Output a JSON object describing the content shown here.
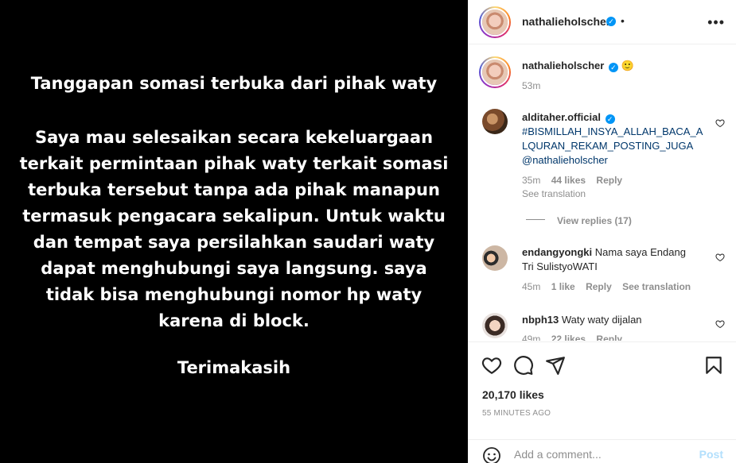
{
  "post_image": {
    "title": "Tanggapan somasi terbuka dari pihak waty",
    "body_lines": [
      "Saya mau selesaikan secara kekeluargaan",
      "terkait permintaan pihak waty terkait somasi",
      "terbuka tersebut tanpa ada pihak manapun",
      "termasuk pengacara sekalipun. Untuk waktu",
      "dan tempat saya persilahkan saudari waty",
      "dapat menghubungi saya langsung. saya",
      "tidak bisa menghubungi nomor hp waty",
      "karena di block."
    ],
    "sign_off": "Terimakasih"
  },
  "header": {
    "username": "nathalieholscher",
    "separator": "•",
    "more_icon": "more-horizontal-icon"
  },
  "caption": {
    "username": "nathalieholscher",
    "text": "🙂",
    "time": "53m"
  },
  "comments": [
    {
      "username": "alditaher.official",
      "verified": true,
      "text_lines": [
        "#BISMILLAH_INSYA_ALLAH_BACA_A",
        "LQURAN_REKAM_POSTING_JUGA"
      ],
      "mention": "@nathalieholscher",
      "time": "35m",
      "likes": "44 likes",
      "reply": "Reply",
      "translate": "See translation",
      "view_replies": "View replies (17)"
    },
    {
      "username": "endangyongki",
      "text_lines": [
        "Nama saya Endang",
        "Tri SulistyoWATI"
      ],
      "time": "45m",
      "likes": "1 like",
      "reply": "Reply",
      "translate": "See translation"
    },
    {
      "username": "nbph13",
      "text_lines": [
        "Waty waty dijalan"
      ],
      "time": "49m",
      "likes": "22 likes",
      "reply": "Reply"
    }
  ],
  "actions": {
    "likes_count": "20,170 likes",
    "time_ago": "55 MINUTES AGO",
    "comment_placeholder": "Add a comment...",
    "post_label": "Post"
  },
  "colors": {
    "accent": "#0095f6",
    "hashtag": "#00376b",
    "muted": "#8e8e8e",
    "post_disabled": "#b2dffc"
  }
}
